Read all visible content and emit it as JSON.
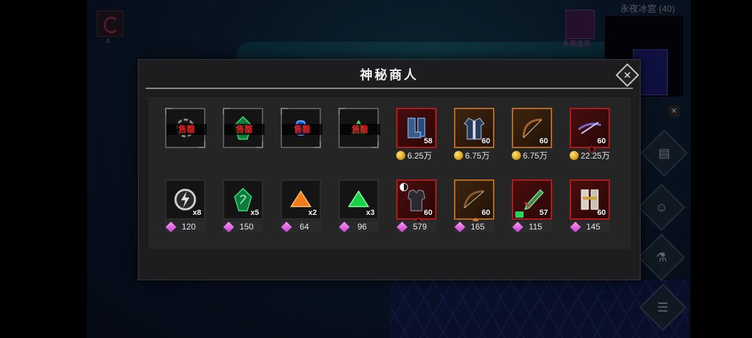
{
  "hud": {
    "minimap_title": "永夜冰宫 (40)",
    "skill_count": "4",
    "quest_label": "永夜迷宫",
    "small_close": "✕"
  },
  "modal": {
    "title": "神秘商人",
    "close_label": "✕",
    "sold_label": "售罄"
  },
  "row1": [
    {
      "name": "mystic-ring",
      "qty": "",
      "price": "",
      "currency": "none",
      "sold": true,
      "rarity": "plain"
    },
    {
      "name": "jade-rune",
      "qty": "",
      "price": "",
      "currency": "none",
      "sold": true,
      "rarity": "plain"
    },
    {
      "name": "blue-gem",
      "qty": "",
      "price": "",
      "currency": "none",
      "sold": true,
      "rarity": "plain"
    },
    {
      "name": "green-gem",
      "qty": "",
      "price": "",
      "currency": "none",
      "sold": true,
      "rarity": "plain"
    },
    {
      "name": "frost-boots",
      "qty": "58",
      "price": "6.25万",
      "currency": "gold",
      "sold": false,
      "rarity": "red",
      "marker": "none"
    },
    {
      "name": "cloth-robe",
      "qty": "60",
      "price": "6.75万",
      "currency": "gold",
      "sold": false,
      "rarity": "orange",
      "marker": "none"
    },
    {
      "name": "longbow",
      "qty": "60",
      "price": "6.75万",
      "currency": "gold",
      "sold": false,
      "rarity": "orange",
      "marker": "none"
    },
    {
      "name": "crossbow",
      "qty": "60",
      "price": "22.25万",
      "currency": "gold",
      "sold": false,
      "rarity": "red",
      "marker": "red"
    }
  ],
  "row2": [
    {
      "name": "lightning-rune",
      "qty": "x8",
      "price": "120",
      "currency": "gem",
      "rarity": "plain"
    },
    {
      "name": "jade-rune",
      "qty": "x5",
      "price": "150",
      "currency": "gem",
      "rarity": "plain"
    },
    {
      "name": "orange-crystal",
      "qty": "x2",
      "price": "64",
      "currency": "gem",
      "rarity": "plain"
    },
    {
      "name": "green-crystal",
      "qty": "x3",
      "price": "96",
      "currency": "gem",
      "rarity": "plain"
    },
    {
      "name": "dark-armor",
      "qty": "60",
      "price": "579",
      "currency": "gem",
      "rarity": "red",
      "marker": "red",
      "yinyang": true
    },
    {
      "name": "recurve-bow",
      "qty": "60",
      "price": "165",
      "currency": "gem",
      "rarity": "orange",
      "marker": "orange"
    },
    {
      "name": "serpent-blade",
      "qty": "57",
      "price": "115",
      "currency": "gem",
      "rarity": "red",
      "book": true
    },
    {
      "name": "bone-greaves",
      "qty": "60",
      "price": "145",
      "currency": "gem",
      "rarity": "red"
    }
  ],
  "colors": {
    "rare_red": "#b01c1c",
    "epic_orange": "#b76a22",
    "sold_text": "#e02020",
    "gem": "#d46be6",
    "gold": "#f0b429"
  }
}
